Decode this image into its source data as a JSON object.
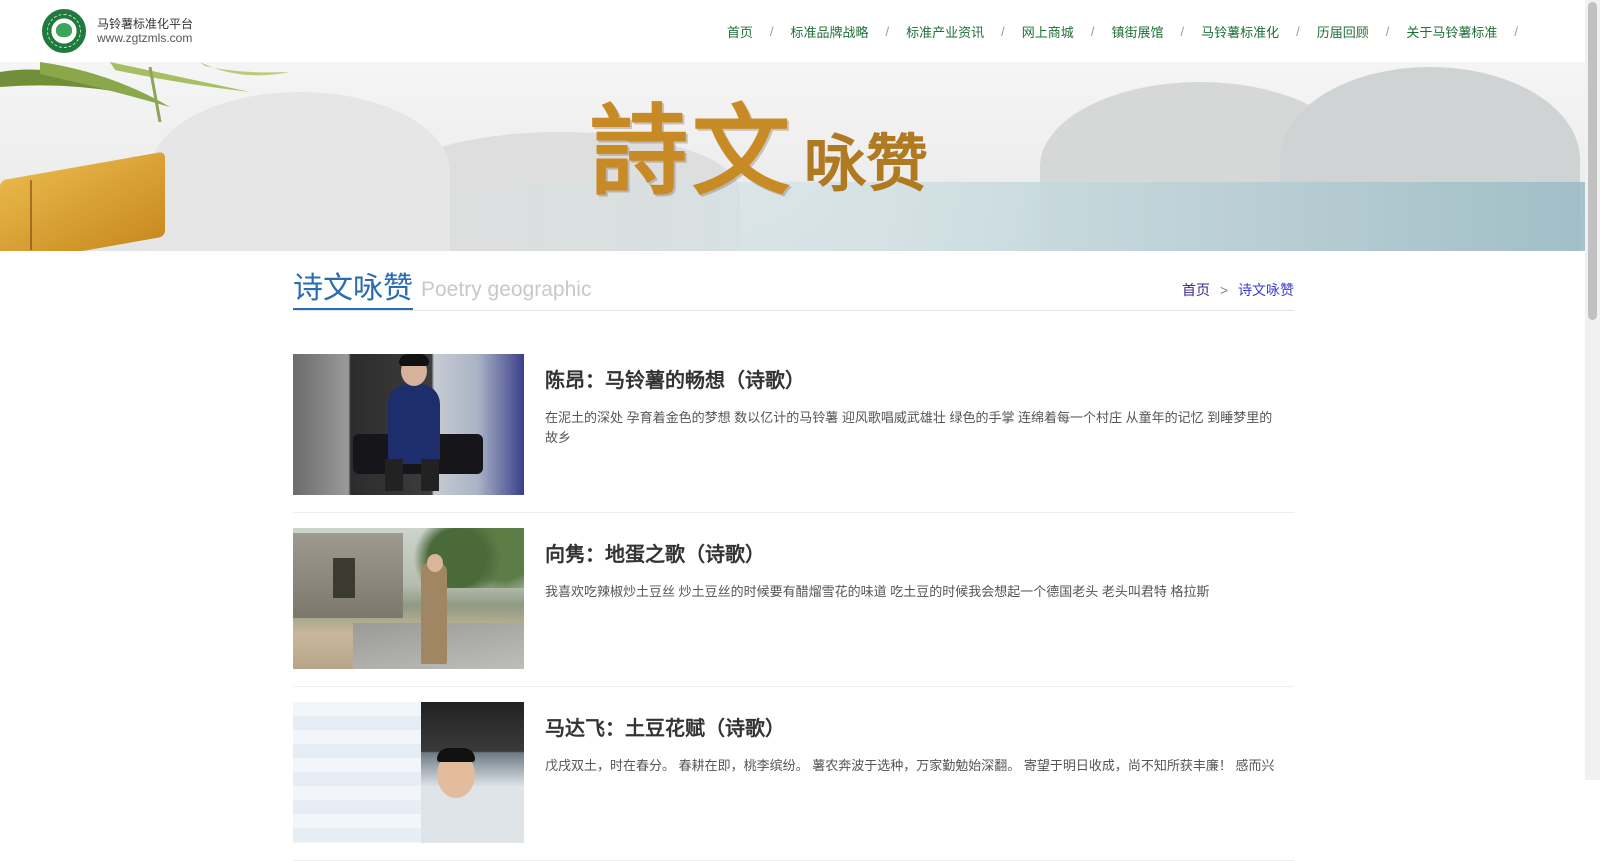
{
  "header": {
    "brand_name": "马铃薯标准化平台",
    "brand_url": "www.zgtzmls.com",
    "nav": [
      {
        "label": "首页"
      },
      {
        "label": "标准品牌战略"
      },
      {
        "label": "标准产业资讯"
      },
      {
        "label": "网上商城"
      },
      {
        "label": "镇街展馆"
      },
      {
        "label": "马铃薯标准化"
      },
      {
        "label": "历届回顾"
      },
      {
        "label": "关于马铃薯标准"
      }
    ],
    "nav_separator": "/"
  },
  "banner": {
    "title_big": "詩文",
    "title_small": "咏赞"
  },
  "section": {
    "title": "诗文咏赞",
    "subtitle": "Poetry geographic",
    "breadcrumb": {
      "home": "首页",
      "separator": ">",
      "current": "诗文咏赞"
    }
  },
  "articles": [
    {
      "title": "陈昂：马铃薯的畅想（诗歌）",
      "excerpt": "在泥土的深处 孕育着金色的梦想 数以亿计的马铃薯 迎风歌唱威武雄壮 绿色的手掌 连绵着每一个村庄 从童年的记忆 到睡梦里的故乡"
    },
    {
      "title": "向隽：地蛋之歌（诗歌）",
      "excerpt": "我喜欢吃辣椒炒土豆丝 炒土豆丝的时候要有醋熘雪花的味道 吃土豆的时候我会想起一个德国老头 老头叫君特 格拉斯"
    },
    {
      "title": "马达飞：土豆花赋（诗歌）",
      "excerpt": "戊戌双土，时在春分。 春耕在即，桃李缤纷。 薯农奔波于选种，万家勤勉始深翻。 寄望于明日收成，尚不知所获丰廉！ 感而兴"
    }
  ],
  "colors": {
    "nav_text": "#1f6f36",
    "section_title": "#2a6cb4",
    "banner_gold": "#c78a25"
  }
}
